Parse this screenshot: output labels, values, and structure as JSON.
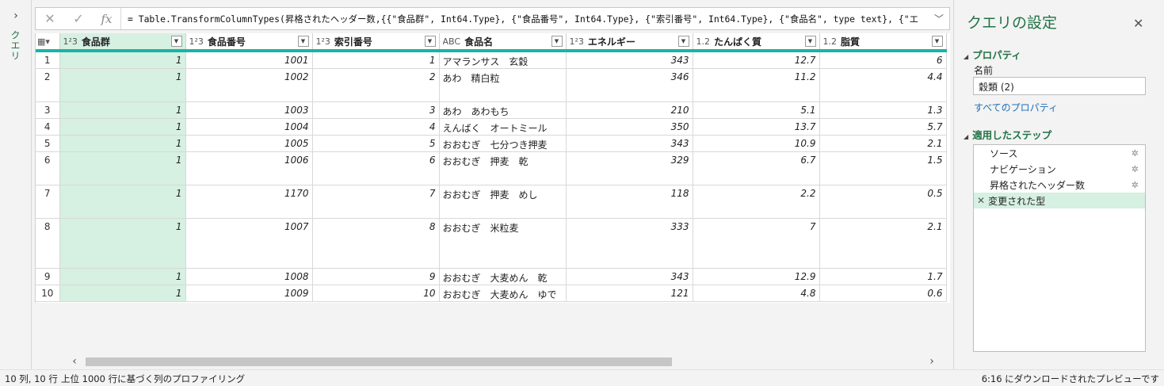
{
  "left_pane": {
    "label": "クエリ",
    "expand_icon": "chevron-right"
  },
  "formula_bar": {
    "cancel_icon": "✕",
    "confirm_icon": "✓",
    "fx_label": "fx",
    "formula": "= Table.TransformColumnTypes(昇格されたヘッダー数,{{\"食品群\", Int64.Type}, {\"食品番号\", Int64.Type}, {\"索引番号\", Int64.Type}, {\"食品名\", type text}, {\"エ"
  },
  "grid": {
    "columns": [
      {
        "type_icon": "1²3",
        "name": "食品群"
      },
      {
        "type_icon": "1²3",
        "name": "食品番号"
      },
      {
        "type_icon": "1²3",
        "name": "索引番号"
      },
      {
        "type_icon": "ABC",
        "name": "食品名"
      },
      {
        "type_icon": "1²3",
        "name": "エネルギー"
      },
      {
        "type_icon": "1.2",
        "name": "たんぱく質"
      },
      {
        "type_icon": "1.2",
        "name": "脂質"
      }
    ],
    "rows": [
      [
        "1",
        "1",
        "1001",
        "1",
        "アマランサス　玄穀",
        "343",
        "12.7",
        "6"
      ],
      [
        "2",
        "1",
        "1002",
        "2",
        "あわ　精白粒",
        "346",
        "11.2",
        "4.4"
      ],
      [
        "3",
        "1",
        "1003",
        "3",
        "あわ　あわもち",
        "210",
        "5.1",
        "1.3"
      ],
      [
        "4",
        "1",
        "1004",
        "4",
        "えんばく　オートミール",
        "350",
        "13.7",
        "5.7"
      ],
      [
        "5",
        "1",
        "1005",
        "5",
        "おおむぎ　七分つき押麦",
        "343",
        "10.9",
        "2.1"
      ],
      [
        "6",
        "1",
        "1006",
        "6",
        "おおむぎ　押麦　乾",
        "329",
        "6.7",
        "1.5"
      ],
      [
        "7",
        "1",
        "1170",
        "7",
        "おおむぎ　押麦　めし",
        "118",
        "2.2",
        "0.5"
      ],
      [
        "8",
        "1",
        "1007",
        "8",
        "おおむぎ　米粒麦",
        "333",
        "7",
        "2.1"
      ],
      [
        "9",
        "1",
        "1008",
        "9",
        "おおむぎ　大麦めん　乾",
        "343",
        "12.9",
        "1.7"
      ],
      [
        "10",
        "1",
        "1009",
        "10",
        "おおむぎ　大麦めん　ゆで",
        "121",
        "4.8",
        "0.6"
      ]
    ]
  },
  "settings": {
    "title": "クエリの設定",
    "close_icon": "✕",
    "properties_header": "プロパティ",
    "name_label": "名前",
    "name_value": "穀類 (2)",
    "all_properties_link": "すべてのプロパティ",
    "steps_header": "適用したステップ",
    "steps": [
      {
        "label": "ソース",
        "has_gear": true
      },
      {
        "label": "ナビゲーション",
        "has_gear": true
      },
      {
        "label": "昇格されたヘッダー数",
        "has_gear": true
      },
      {
        "label": "変更された型",
        "has_gear": false,
        "active": true
      }
    ]
  },
  "status_bar": {
    "left": "10 列, 10 行",
    "middle": "上位 1000 行に基づく列のプロファイリング",
    "right": "6:16 にダウンロードされたプレビューです"
  },
  "colors": {
    "accent": "#217346",
    "header_line": "#19b4a5",
    "selected_col": "#d6f0e2"
  }
}
